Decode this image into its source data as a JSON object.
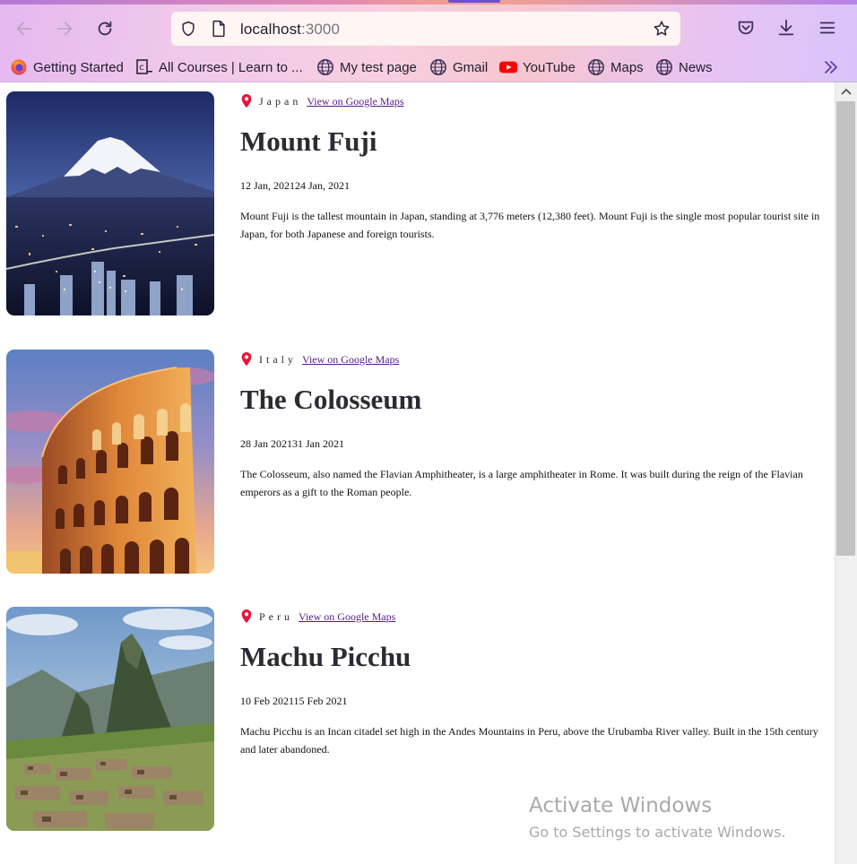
{
  "browser": {
    "url_host": "localhost",
    "url_port": ":3000",
    "bookmarks": [
      {
        "label": "Getting Started",
        "icon": "firefox-icon"
      },
      {
        "label": "All Courses | Learn to ...",
        "icon": "codecademy-icon"
      },
      {
        "label": "My test page",
        "icon": "globe-icon"
      },
      {
        "label": "Gmail",
        "icon": "globe-icon"
      },
      {
        "label": "YouTube",
        "icon": "youtube-icon"
      },
      {
        "label": "Maps",
        "icon": "globe-icon"
      },
      {
        "label": "News",
        "icon": "globe-icon"
      }
    ],
    "colors": {
      "accent": "#6a4fd8",
      "pin": "#e8153a",
      "link": "#551a8b"
    }
  },
  "entries": [
    {
      "country": "Japan",
      "maps_link": "View on Google Maps",
      "title": "Mount Fuji",
      "dates": "12 Jan, 202124 Jan, 2021",
      "description": "Mount Fuji is the tallest mountain in Japan, standing at 3,776 meters (12,380 feet). Mount Fuji is the single most popular tourist site in Japan, for both Japanese and foreign tourists."
    },
    {
      "country": "Italy",
      "maps_link": "View on Google Maps",
      "title": "The Colosseum",
      "dates": "28 Jan 202131 Jan 2021",
      "description": "The Colosseum, also named the Flavian Amphitheater, is a large amphitheater in Rome. It was built during the reign of the Flavian emperors as a gift to the Roman people."
    },
    {
      "country": "Peru",
      "maps_link": "View on Google Maps",
      "title": "Machu Picchu",
      "dates": "10 Feb 202115 Feb 2021",
      "description": "Machu Picchu is an Incan citadel set high in the Andes Mountains in Peru, above the Urubamba River valley. Built in the 15th century and later abandoned."
    }
  ],
  "watermark": {
    "line1": "Activate Windows",
    "line2": "Go to Settings to activate Windows."
  }
}
